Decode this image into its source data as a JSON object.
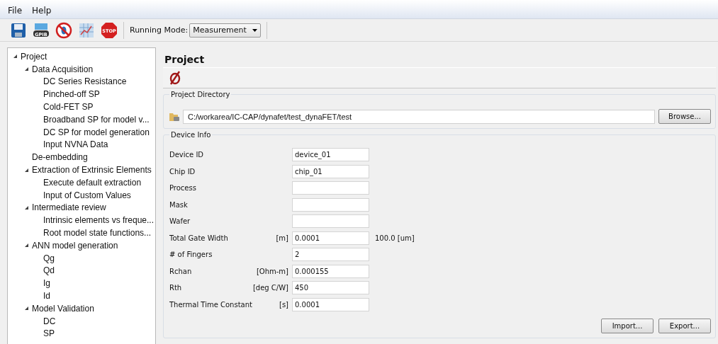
{
  "menu": [
    "File",
    "Help"
  ],
  "toolbar": {
    "icons": [
      {
        "kind": "save"
      },
      {
        "kind": "gpib",
        "label": "GPIB"
      },
      {
        "kind": "nobug"
      },
      {
        "kind": "grid"
      },
      {
        "kind": "stop",
        "label": "STOP"
      }
    ],
    "mode_label": "Running Mode:",
    "mode_value": "Measurement"
  },
  "tree": [
    {
      "label": "Project",
      "expanded": true,
      "selected": false,
      "children": [
        {
          "label": "Data Acquisition",
          "expanded": true,
          "selected": false,
          "children": [
            {
              "label": "DC Series Resistance",
              "selected": false
            },
            {
              "label": "Pinched-off SP",
              "selected": false
            },
            {
              "label": "Cold-FET SP",
              "selected": false
            },
            {
              "label": "Broadband SP for model v...",
              "selected": false
            },
            {
              "label": "DC SP for model generation",
              "selected": false
            },
            {
              "label": "Input NVNA Data",
              "selected": false
            }
          ]
        },
        {
          "label": "De-embedding",
          "selected": false
        },
        {
          "label": "Extraction of Extrinsic Elements",
          "expanded": true,
          "selected": false,
          "children": [
            {
              "label": "Execute default extraction",
              "selected": false
            },
            {
              "label": "Input of Custom Values",
              "selected": false
            }
          ]
        },
        {
          "label": "Intermediate review",
          "expanded": true,
          "selected": false,
          "children": [
            {
              "label": "Intrinsic elements vs freque...",
              "selected": false
            },
            {
              "label": "Root model state functions...",
              "selected": false
            }
          ]
        },
        {
          "label": "ANN model generation",
          "expanded": true,
          "selected": false,
          "children": [
            {
              "label": "Qg",
              "selected": false
            },
            {
              "label": "Qd",
              "selected": false
            },
            {
              "label": "Ig",
              "selected": false
            },
            {
              "label": "Id",
              "selected": false
            }
          ]
        },
        {
          "label": "Model Validation",
          "expanded": true,
          "selected": false,
          "children": [
            {
              "label": "DC",
              "selected": false
            },
            {
              "label": "SP",
              "selected": false
            }
          ]
        }
      ]
    }
  ],
  "panel": {
    "title": "Project",
    "directory": {
      "title": "Project Directory",
      "path": "C:/workarea/IC-CAP/dynafet/test_dynaFET/test",
      "button": "Browse..."
    },
    "device_info": {
      "title": "Device Info",
      "rows": [
        {
          "label": "Device ID",
          "value": "device_01"
        },
        {
          "label": "Chip ID",
          "value": "chip_01"
        },
        {
          "label": "Process"
        },
        {
          "label": "Mask"
        },
        {
          "label": "Wafer"
        },
        {
          "label": "Total Gate Width",
          "unit": "[m]",
          "value": "0.0001",
          "note": "100.0 [um]"
        },
        {
          "label": "# of Fingers",
          "value": "2"
        },
        {
          "label": "Rchan",
          "unit": "[Ohm-m]",
          "value": "0.000155"
        },
        {
          "label": "Rth",
          "unit": "[deg C/W]",
          "value": "450"
        },
        {
          "label": "Thermal Time Constant",
          "unit": "[s]",
          "value": "0.0001"
        }
      ],
      "buttons": [
        "Import...",
        "Export..."
      ]
    }
  }
}
